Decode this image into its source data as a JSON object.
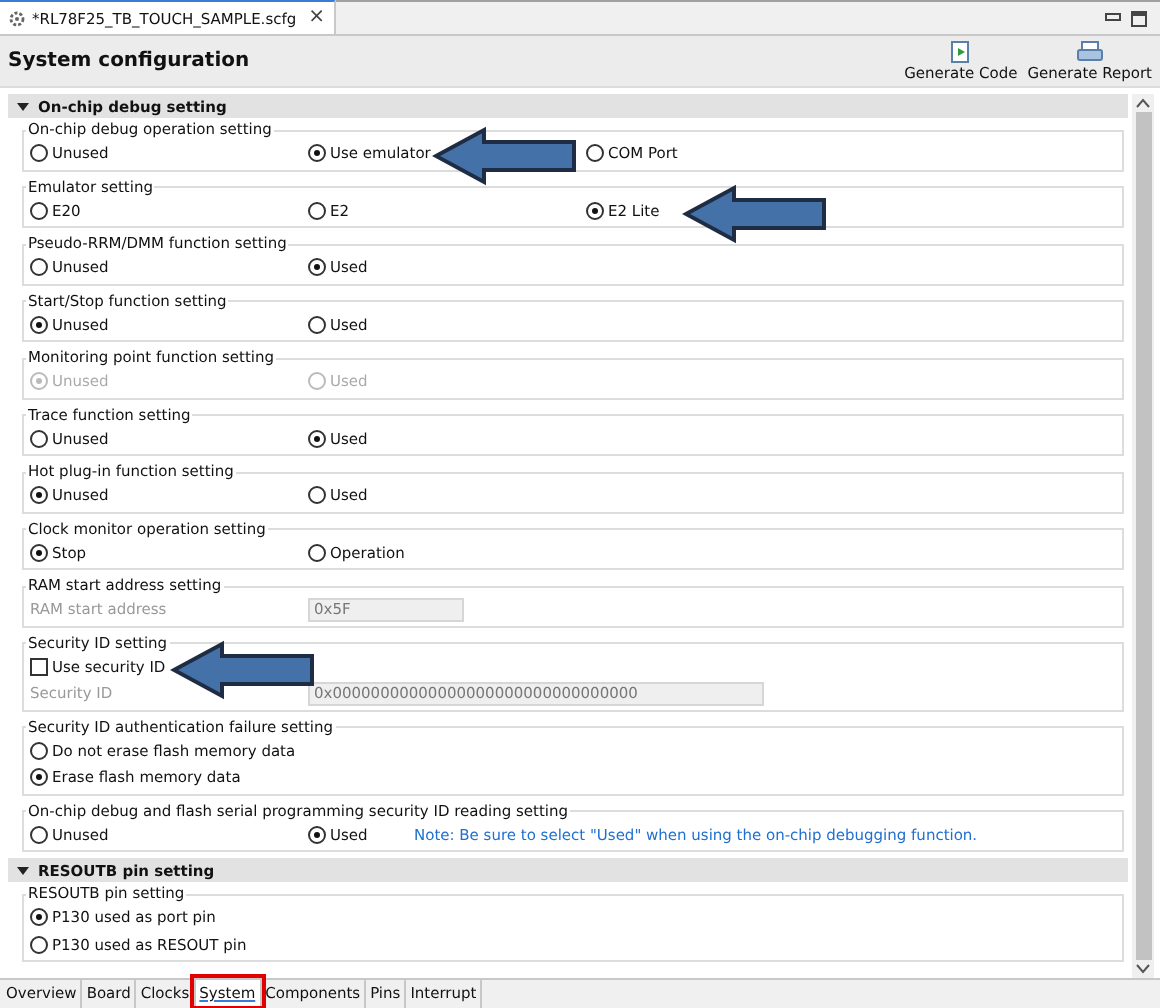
{
  "editor_tab": {
    "title": "*RL78F25_TB_TOUCH_SAMPLE.scfg",
    "close": "×",
    "selected": true
  },
  "page_title": "System configuration",
  "toolbar": [
    {
      "kind": "code",
      "label": "Generate Code"
    },
    {
      "kind": "report",
      "label": "Generate Report"
    }
  ],
  "sections": [
    {
      "title": "On-chip debug setting",
      "expanded": true,
      "groups": [
        {
          "title": "On-chip debug operation setting",
          "rows": [
            {
              "kind": "radios",
              "disabled": false,
              "options": [
                {
                  "label": "Unused",
                  "selected": false
                },
                {
                  "label": "Use emulator",
                  "selected": true,
                  "callout": true
                },
                {
                  "label": "COM Port",
                  "selected": false
                }
              ]
            }
          ]
        },
        {
          "title": "Emulator setting",
          "rows": [
            {
              "kind": "radios",
              "disabled": false,
              "options": [
                {
                  "label": "E20",
                  "selected": false
                },
                {
                  "label": "E2",
                  "selected": false
                },
                {
                  "label": "E2 Lite",
                  "selected": true,
                  "callout": true
                }
              ]
            }
          ]
        },
        {
          "title": "Pseudo-RRM/DMM function setting",
          "rows": [
            {
              "kind": "radios",
              "disabled": false,
              "options": [
                {
                  "label": "Unused",
                  "selected": false
                },
                {
                  "label": "Used",
                  "selected": true
                }
              ]
            }
          ]
        },
        {
          "title": "Start/Stop function setting",
          "rows": [
            {
              "kind": "radios",
              "disabled": false,
              "options": [
                {
                  "label": "Unused",
                  "selected": true
                },
                {
                  "label": "Used",
                  "selected": false
                }
              ]
            }
          ]
        },
        {
          "title": "Monitoring point function setting",
          "rows": [
            {
              "kind": "radios",
              "disabled": true,
              "options": [
                {
                  "label": "Unused",
                  "selected": true
                },
                {
                  "label": "Used",
                  "selected": false
                }
              ]
            }
          ]
        },
        {
          "title": "Trace function setting",
          "rows": [
            {
              "kind": "radios",
              "disabled": false,
              "options": [
                {
                  "label": "Unused",
                  "selected": false
                },
                {
                  "label": "Used",
                  "selected": true
                }
              ]
            }
          ]
        },
        {
          "title": "Hot plug-in function setting",
          "rows": [
            {
              "kind": "radios",
              "disabled": false,
              "options": [
                {
                  "label": "Unused",
                  "selected": true
                },
                {
                  "label": "Used",
                  "selected": false
                }
              ]
            }
          ]
        },
        {
          "title": "Clock monitor operation setting",
          "rows": [
            {
              "kind": "radios",
              "disabled": false,
              "options": [
                {
                  "label": "Stop",
                  "selected": true
                },
                {
                  "label": "Operation",
                  "selected": false
                }
              ]
            }
          ]
        },
        {
          "title": "RAM start address setting",
          "rows": [
            {
              "kind": "field",
              "label": "RAM start address",
              "value": "0x5F",
              "disabled": true,
              "wide": false
            }
          ]
        },
        {
          "title": "Security ID setting",
          "rows": [
            {
              "kind": "checkbox",
              "label": "Use security ID",
              "checked": false,
              "callout": true
            },
            {
              "kind": "field",
              "label": "Security ID",
              "value": "0x00000000000000000000000000000000",
              "disabled": true,
              "wide": true
            }
          ]
        },
        {
          "title": "Security ID authentication failure setting",
          "rows": [
            {
              "kind": "radios",
              "disabled": false,
              "options": [
                {
                  "label": "Do not erase flash memory data",
                  "selected": false
                }
              ]
            },
            {
              "kind": "radios",
              "disabled": false,
              "options": [
                {
                  "label": "Erase flash memory data",
                  "selected": true
                }
              ]
            }
          ]
        },
        {
          "title": "On-chip debug and flash serial programming security ID reading setting",
          "rows": [
            {
              "kind": "radios",
              "disabled": false,
              "options": [
                {
                  "label": "Unused",
                  "selected": false
                },
                {
                  "label": "Used",
                  "selected": true
                }
              ],
              "note": "Note: Be sure to select \"Used\" when using the on-chip debugging function."
            }
          ]
        }
      ]
    },
    {
      "title": "RESOUTB pin setting",
      "expanded": true,
      "groups": [
        {
          "title": "RESOUTB pin setting",
          "rows": [
            {
              "kind": "radios",
              "disabled": false,
              "options": [
                {
                  "label": "P130 used as port pin",
                  "selected": true
                }
              ]
            },
            {
              "kind": "radios",
              "disabled": false,
              "options": [
                {
                  "label": "P130 used as RESOUT pin",
                  "selected": false
                }
              ]
            }
          ]
        }
      ]
    }
  ],
  "bottom_tabs": [
    {
      "label": "Overview",
      "selected": false,
      "highlighted": false
    },
    {
      "label": "Board",
      "selected": false,
      "highlighted": false
    },
    {
      "label": "Clocks",
      "selected": false,
      "highlighted": false
    },
    {
      "label": "System",
      "selected": true,
      "highlighted": true
    },
    {
      "label": "Components",
      "selected": false,
      "highlighted": false
    },
    {
      "label": "Pins",
      "selected": false,
      "highlighted": false
    },
    {
      "label": "Interrupt",
      "selected": false,
      "highlighted": false
    }
  ]
}
